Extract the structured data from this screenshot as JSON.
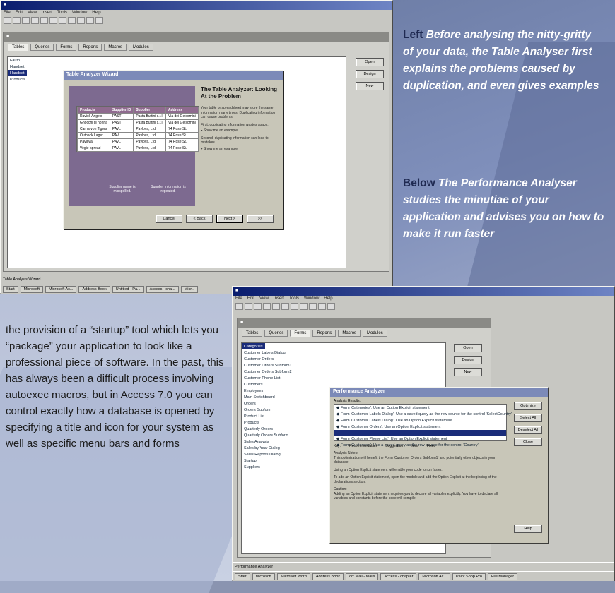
{
  "caption_left": {
    "key": "Left",
    "text": "Before analysing the nitty-gritty of your data, the Table Analyser first explains the problems caused by duplication, and even gives examples"
  },
  "caption_below": {
    "key": "Below",
    "text": "The Performance Analyser studies the minutiae of your application and advises you on how to make it run faster"
  },
  "body_text": "the provision of a “startup” tool which lets you “package” your application to look like a professional piece of software. In the past, this has always been a difficult process involving autoexec macros, but in Access 7.0 you can control exactly how a database is opened by specifying a title and icon for your system as well as specific menu bars and forms",
  "menu": [
    "File",
    "Edit",
    "View",
    "Insert",
    "Tools",
    "Window",
    "Help"
  ],
  "tabs": [
    "Tables",
    "Queries",
    "Forms",
    "Reports",
    "Macros",
    "Modules"
  ],
  "buttons": {
    "open": "Open",
    "design": "Design",
    "new": "New"
  },
  "top_window": {
    "tables": [
      "Fauth",
      "Handset",
      "Handset",
      "Products"
    ],
    "status": "Table Analysis Wizard",
    "taskbar": [
      "Start",
      "Microsoft",
      "Microsoft Ac...",
      "Address Book",
      "Untitled - Pa...",
      "Access - cha...",
      "Micr..."
    ]
  },
  "table_analyzer": {
    "title": "Table Analyzer Wizard",
    "heading": "The Table Analyzer: Looking At the Problem",
    "p1": "Your table or spreadsheet may store the same information many times. Duplicating information can cause problems.",
    "p2": "First, duplicating information wastes space.",
    "show1": "Show me an example.",
    "p3": "Second, duplicating information can lead to mistakes.",
    "show2": "Show me an example.",
    "left_note": "Supplier name is misspelled.",
    "right_note": "Supplier information is repeated.",
    "columns": [
      "Products",
      "Supplier ID",
      "Supplier",
      "Address"
    ],
    "rows": [
      [
        "Ravioli Angelo",
        "PAST",
        "Pasta Buttini s.r.l.",
        "Via dei Gelsomini"
      ],
      [
        "Gnocchi di nonna",
        "PAST",
        "Pasta Buttini s.r.l.",
        "Via dei Gelsomini"
      ],
      [
        "Carnarvon Tigers",
        "PAVL",
        "Pavlova, Ltd.",
        "74 Rose St."
      ],
      [
        "Outback Lager",
        "PAVL",
        "Pavlova, Ltd.",
        "74 Rose St."
      ],
      [
        "Pavlova",
        "PAVL",
        "Pavlova, Ltd.",
        "74 Rose St."
      ],
      [
        "Vegie-spread",
        "PAVL",
        "Pavlova, Ltd.",
        "74 Rose St."
      ]
    ],
    "cancel": "Cancel",
    "back": "< Back",
    "next": "Next >",
    "finish": ">>"
  },
  "bottom_window": {
    "tables": [
      "Categories",
      "Customer Labels Dialog",
      "Customer Orders",
      "Customer Orders Subform1",
      "Customer Orders Subform2",
      "Customer Phone List",
      "Customers",
      "Employees",
      "Main Switchboard",
      "Orders",
      "Orders Subform",
      "Product List",
      "Products",
      "Quarterly Orders",
      "Quarterly Orders Subform",
      "Sales Analysis",
      "Sales by Year Dialog",
      "Sales Reports Dialog",
      "Startup",
      "Suppliers"
    ],
    "status": "Performance Analyzer",
    "taskbar": [
      "Start",
      "Microsoft",
      "Microsoft Word",
      "Address Book",
      "cc: Mail - Mails",
      "Access - chapter",
      "Microsoft Ac...",
      "Paint Shop Pro",
      "File Manager"
    ]
  },
  "perf_analyzer": {
    "title": "Performance Analyzer",
    "results_label": "Analysis Results:",
    "results": [
      "Form 'Categories': Use an Option Explicit statement",
      "Form 'Customer Labels Dialog': Use a saved query as the row source for the control 'SelectCountry'",
      "Form 'Customer Labels Dialog': Use an Option Explicit statement",
      "Form 'Customer Orders': Use an Option Explicit statement",
      "",
      "Form 'Customer Phone List': Use an Option Explicit statement",
      "Form 'Customers': Use a saved query as the row source for the control 'Country'"
    ],
    "key_label": "Key:",
    "key": [
      "Recommendation",
      "Suggestion",
      "Idea",
      "Fixed"
    ],
    "notes_label": "Analysis Notes:",
    "notes1": "This optimization will benefit the Form 'Customer Orders Subform1' and potentially other objects in your database.",
    "notes2": "Using an Option Explicit statement will enable your code to run faster.",
    "notes3": "To add an Option Explicit statement, open the module and add the Option Explicit at the beginning of the declarations section.",
    "caution": "Caution:",
    "caution_text": "Adding an Option Explicit statement requires you to declare all variables explicitly. You have to declare all variables and constants before the code will compile.",
    "buttons": [
      "Optimize",
      "Select All",
      "Deselect All",
      "Close",
      "Help"
    ]
  }
}
